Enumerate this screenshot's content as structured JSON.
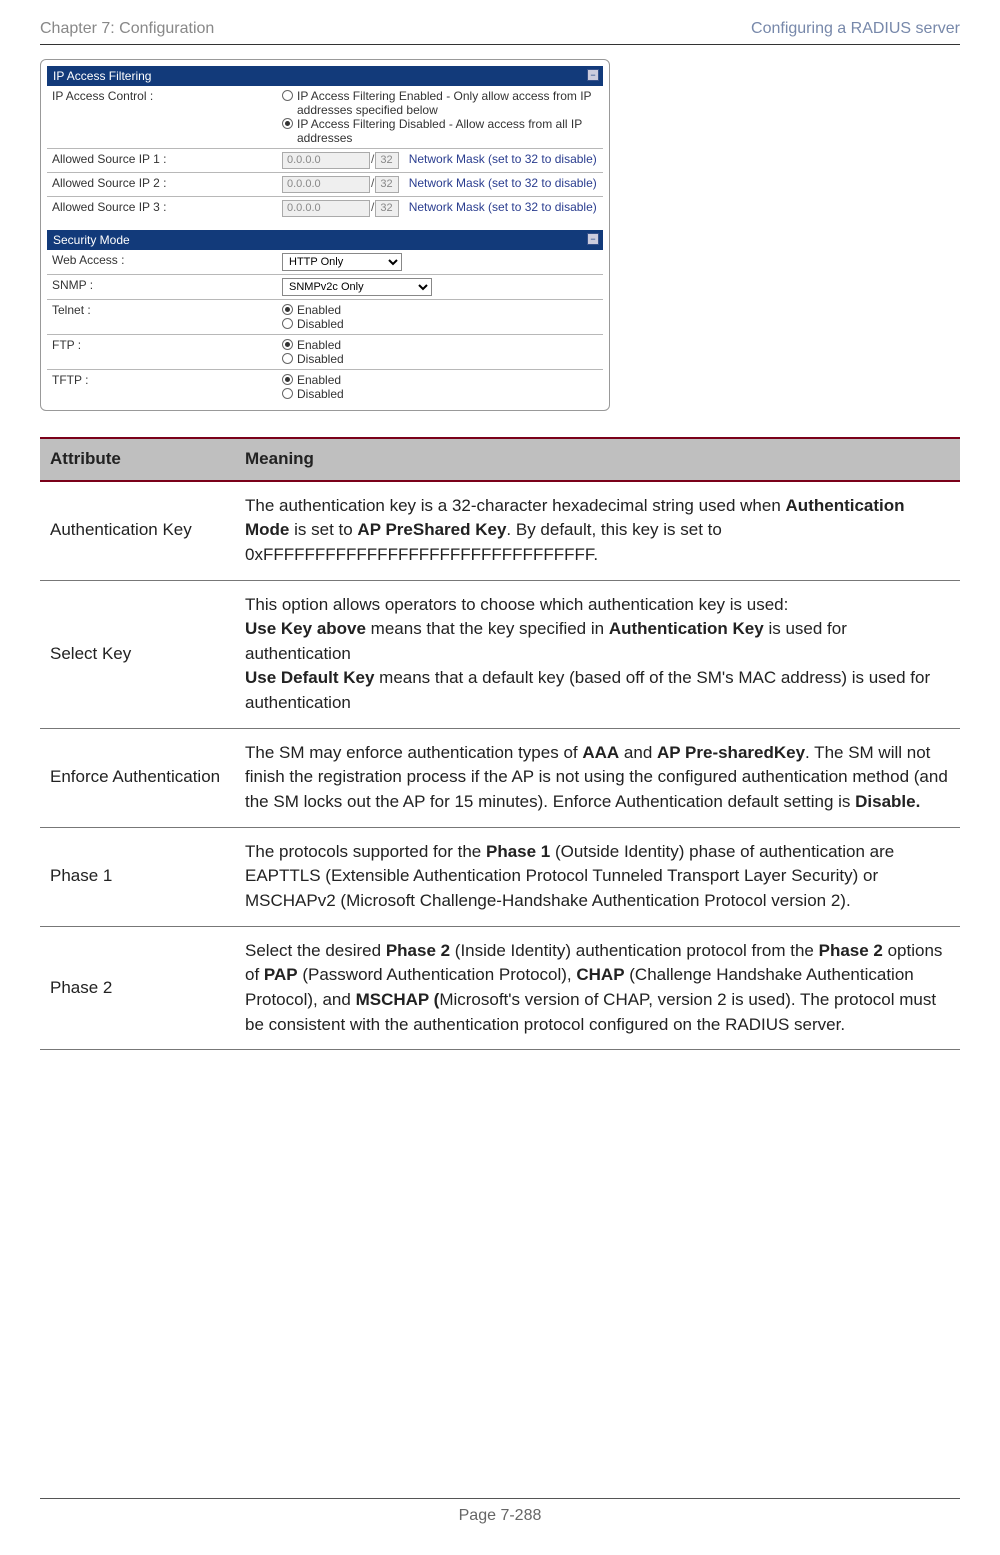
{
  "header": {
    "left": "Chapter 7:  Configuration",
    "right": "Configuring a RADIUS server"
  },
  "screenshot": {
    "ip_panel": {
      "title": "IP Access Filtering",
      "control_label": "IP Access Control :",
      "opt_enabled": "IP Access Filtering Enabled - Only allow access from IP addresses specified below",
      "opt_disabled": "IP Access Filtering Disabled - Allow access from all IP addresses",
      "rows": [
        {
          "label": "Allowed Source IP 1 :",
          "ip": "0.0.0.0",
          "mask": "32",
          "note": "Network Mask (set to 32 to disable)"
        },
        {
          "label": "Allowed Source IP 2 :",
          "ip": "0.0.0.0",
          "mask": "32",
          "note": "Network Mask (set to 32 to disable)"
        },
        {
          "label": "Allowed Source IP 3 :",
          "ip": "0.0.0.0",
          "mask": "32",
          "note": "Network Mask (set to 32 to disable)"
        }
      ]
    },
    "sec_panel": {
      "title": "Security Mode",
      "rows": {
        "web": {
          "label": "Web Access :",
          "value": "HTTP Only"
        },
        "snmp": {
          "label": "SNMP :",
          "value": "SNMPv2c Only"
        },
        "telnet": {
          "label": "Telnet :",
          "enabled": "Enabled",
          "disabled": "Disabled"
        },
        "ftp": {
          "label": "FTP :",
          "enabled": "Enabled",
          "disabled": "Disabled"
        },
        "tftp": {
          "label": "TFTP :",
          "enabled": "Enabled",
          "disabled": "Disabled"
        }
      }
    }
  },
  "attr_table": {
    "h1": "Attribute",
    "h2": "Meaning",
    "rows": {
      "authkey": {
        "name": "Authentication Key",
        "p1a": "The authentication key is a 32-character hexadecimal string used when ",
        "p1b": "Authentication Mode",
        "p1c": " is set to ",
        "p1d": "AP PreShared Key",
        "p1e": ". By default, this key is set to 0xFFFFFFFFFFFFFFFFFFFFFFFFFFFFFFFF."
      },
      "selkey": {
        "name": "Select Key",
        "p1": "This option allows operators to choose which authentication key is used:",
        "p2a": "Use Key above",
        "p2b": " means that the key specified in ",
        "p2c": "Authentication Key",
        "p2d": " is used for authentication",
        "p3a": "Use Default Key",
        "p3b": " means that a default key (based off of the SM's MAC address) is used for authentication"
      },
      "enforce": {
        "name": "Enforce Authentication",
        "p1a": "The SM may enforce authentication types of ",
        "p1b": "AAA",
        "p1c": " and ",
        "p1d": "AP Pre-sharedKey",
        "p1e": ". The SM will not finish the registration process if the AP is not using the configured authentication method (and the SM locks out the AP for 15 minutes). Enforce Authentication default setting is ",
        "p1f": "Disable."
      },
      "phase1": {
        "name": "Phase 1",
        "p1a": "The protocols supported for the ",
        "p1b": "Phase 1",
        "p1c": " (Outside Identity) phase of authentication are EAPTTLS (Extensible Authentication Protocol Tunneled Transport Layer Security) or MSCHAPv2 (Microsoft Challenge-Handshake Authentication Protocol version 2)."
      },
      "phase2": {
        "name": "Phase 2",
        "p1a": "Select the desired ",
        "p1b": "Phase 2",
        "p1c": " (Inside Identity) authentication protocol from the ",
        "p1d": "Phase 2",
        "p1e": " options of ",
        "p1f": "PAP",
        "p1g": " (Password Authentication Protocol), ",
        "p1h": "CHAP",
        "p1i": " (Challenge Handshake Authentication Protocol), and ",
        "p1j": "MSCHAP (",
        "p1k": "Microsoft's version of CHAP, version 2 is used). The protocol must be consistent with the authentication protocol configured on the RADIUS server."
      }
    }
  },
  "footer": "Page 7-288"
}
